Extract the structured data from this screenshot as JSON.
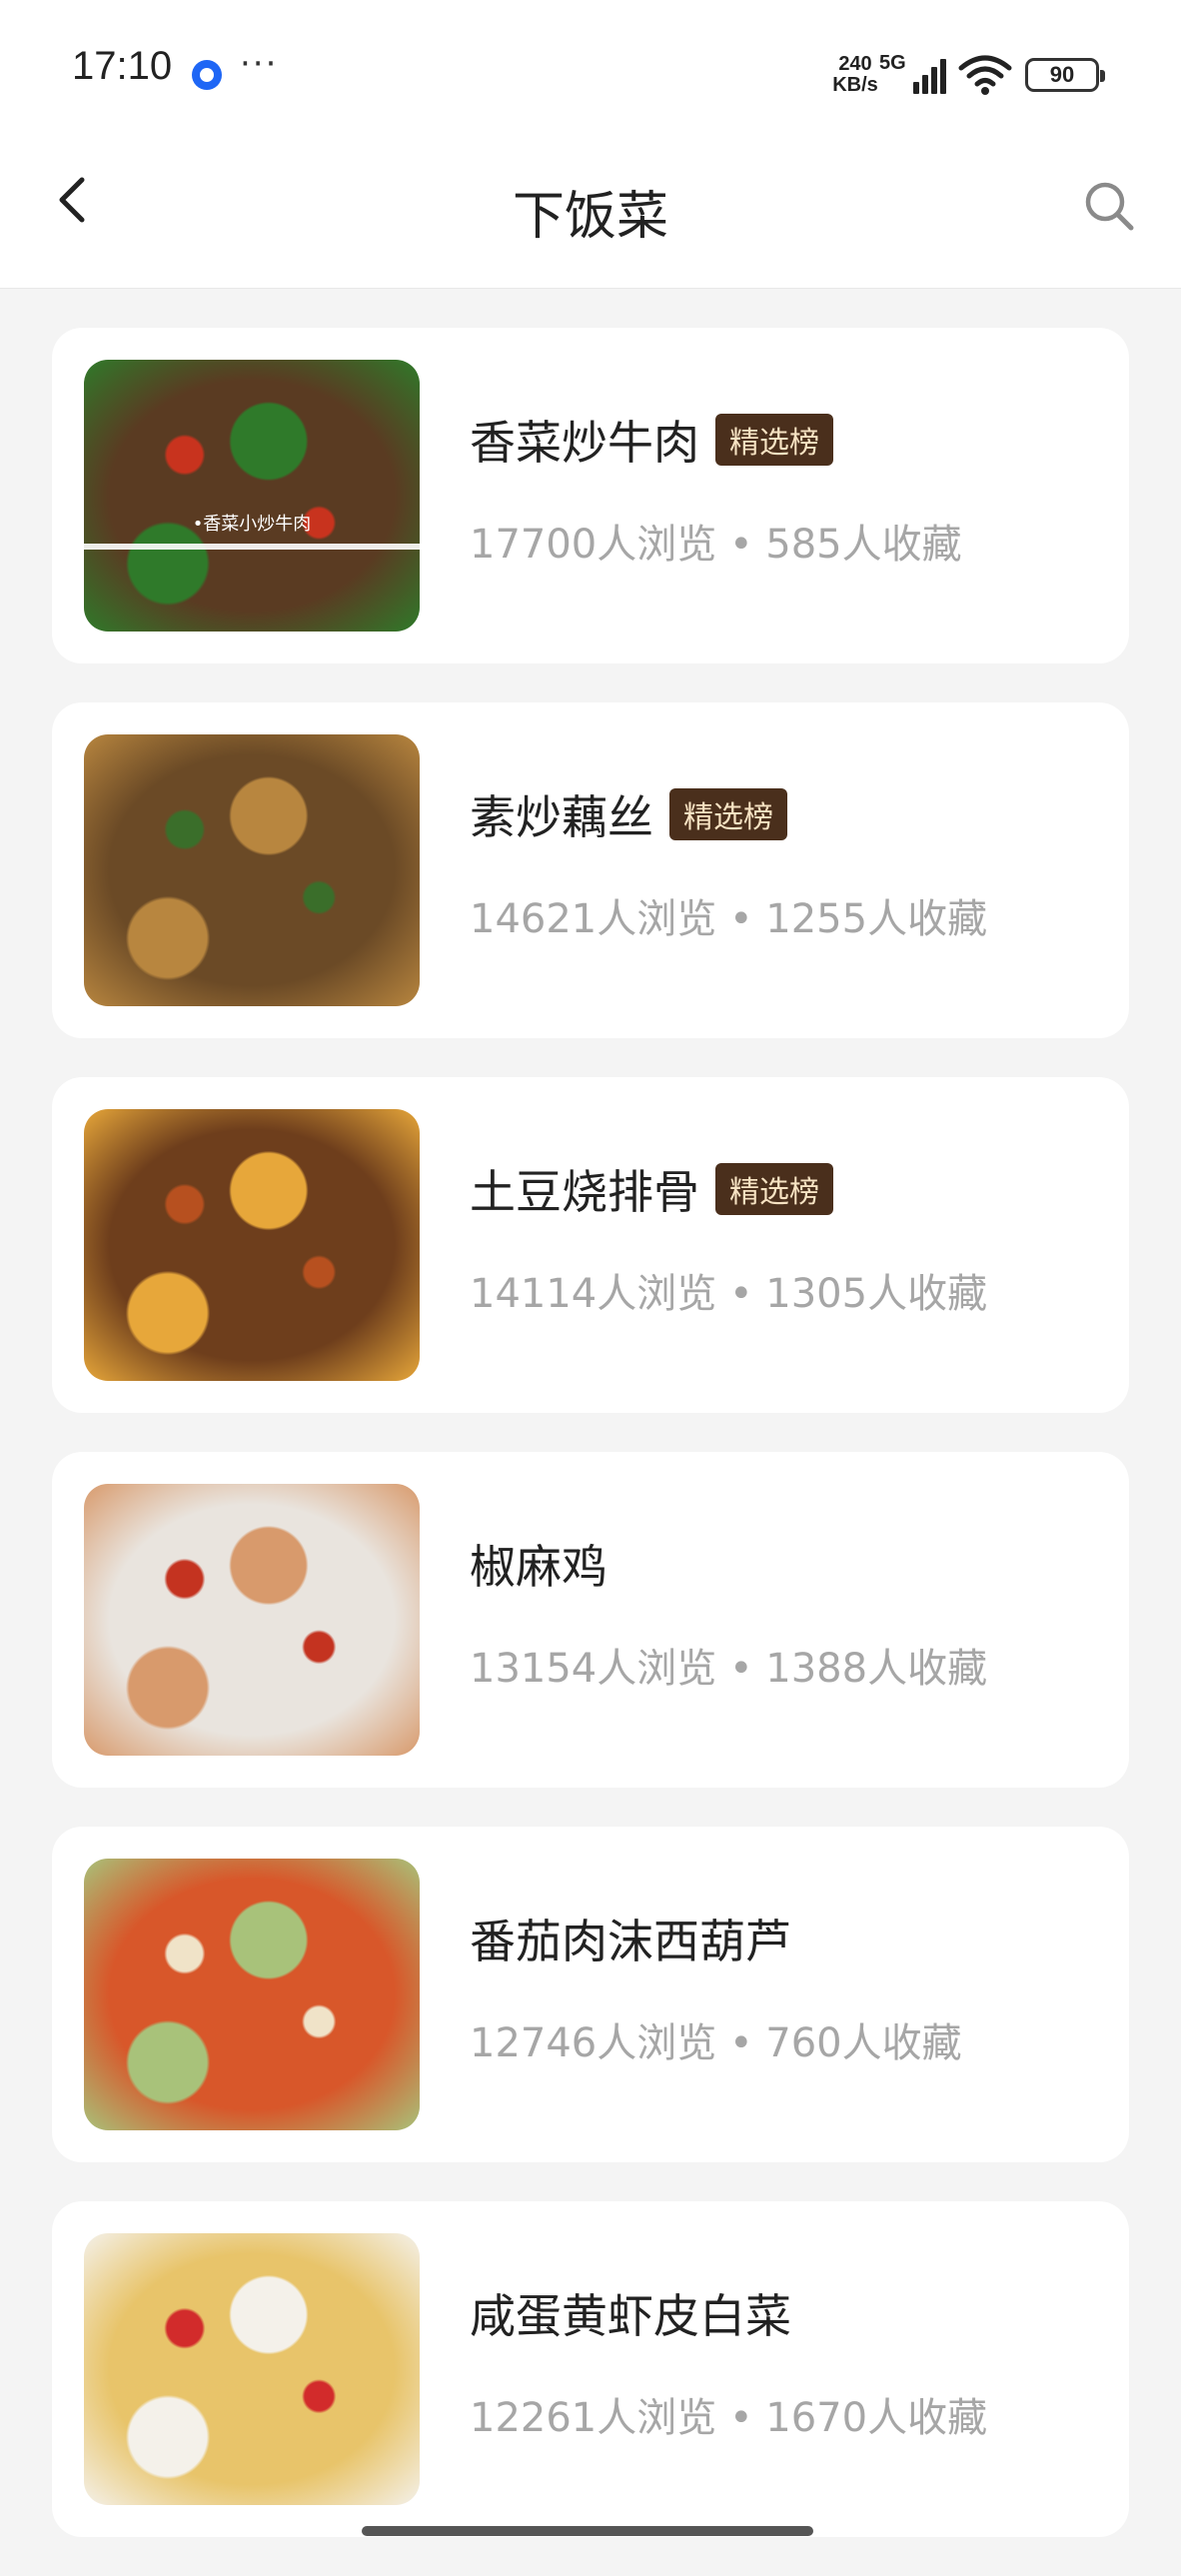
{
  "status_bar": {
    "time": "17:10",
    "dots": "···",
    "net_speed_value": "240",
    "net_speed_unit": "KB/s",
    "network_type": "5G",
    "battery": "90",
    "icons": [
      "app-notification-icon",
      "signal-icon",
      "wifi-icon",
      "battery-icon"
    ]
  },
  "header": {
    "title": "下饭菜",
    "back_icon": "chevron-left-icon",
    "search_icon": "search-icon"
  },
  "recipes": [
    {
      "name": "香菜炒牛肉",
      "badge": "精选榜",
      "stats": "17700人浏览 • 585人收藏",
      "thumb_caption": "•香菜小炒牛肉",
      "thumb_colors": [
        "#5a3b22",
        "#2f7a2a",
        "#c8331e"
      ]
    },
    {
      "name": "素炒藕丝",
      "badge": "精选榜",
      "stats": "14621人浏览 • 1255人收藏",
      "thumb_colors": [
        "#6b4a26",
        "#b8863f",
        "#3a6e2a"
      ]
    },
    {
      "name": "土豆烧排骨",
      "badge": "精选榜",
      "stats": "14114人浏览 • 1305人收藏",
      "thumb_colors": [
        "#6e3e1c",
        "#e7a73a",
        "#b7501f"
      ]
    },
    {
      "name": "椒麻鸡",
      "stats": "13154人浏览 • 1388人收藏",
      "thumb_colors": [
        "#e9e4de",
        "#d89a6c",
        "#c43320"
      ]
    },
    {
      "name": "番茄肉沫西葫芦",
      "stats": "12746人浏览 • 760人收藏",
      "thumb_colors": [
        "#d8572a",
        "#a8c27a",
        "#f0e3c8"
      ]
    },
    {
      "name": "咸蛋黄虾皮白菜",
      "stats": "12261人浏览 • 1670人收藏",
      "thumb_colors": [
        "#e8c46a",
        "#f4f1ea",
        "#d22b2b"
      ]
    }
  ]
}
